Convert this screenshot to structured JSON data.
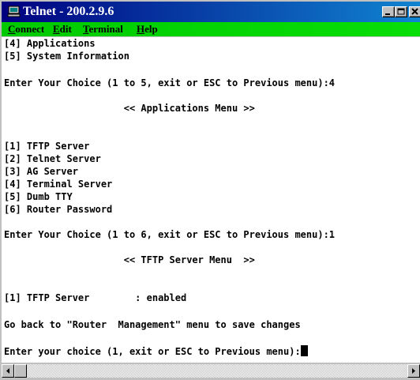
{
  "window": {
    "title": "Telnet - 200.2.9.6",
    "icon": "telnet-computer-icon"
  },
  "menubar": {
    "items": [
      {
        "accel": "C",
        "rest": "onnect"
      },
      {
        "accel": "E",
        "rest": "dit"
      },
      {
        "accel": "T",
        "rest": "erminal"
      },
      {
        "accel": "H",
        "rest": "elp"
      }
    ]
  },
  "terminal": {
    "lines": [
      "[4] Applications",
      "[5] System Information",
      "",
      "Enter Your Choice (1 to 5, exit or ESC to Previous menu):4",
      "",
      "                     << Applications Menu >>",
      "",
      "",
      "[1] TFTP Server",
      "[2] Telnet Server",
      "[3] AG Server",
      "[4] Terminal Server",
      "[5] Dumb TTY",
      "[6] Router Password",
      "",
      "Enter Your Choice (1 to 6, exit or ESC to Previous menu):1",
      "",
      "                     << TFTP Server Menu  >>",
      "",
      "",
      "[1] TFTP Server        : enabled",
      "",
      "Go back to \"Router  Management\" menu to save changes",
      "",
      "Enter your choice (1, exit or ESC to Previous menu):"
    ]
  },
  "colors": {
    "titlebar_start": "#000080",
    "titlebar_end": "#1084d0",
    "menubar": "#00c900",
    "terminal_bg": "#ffffff",
    "terminal_text": "#000000"
  }
}
